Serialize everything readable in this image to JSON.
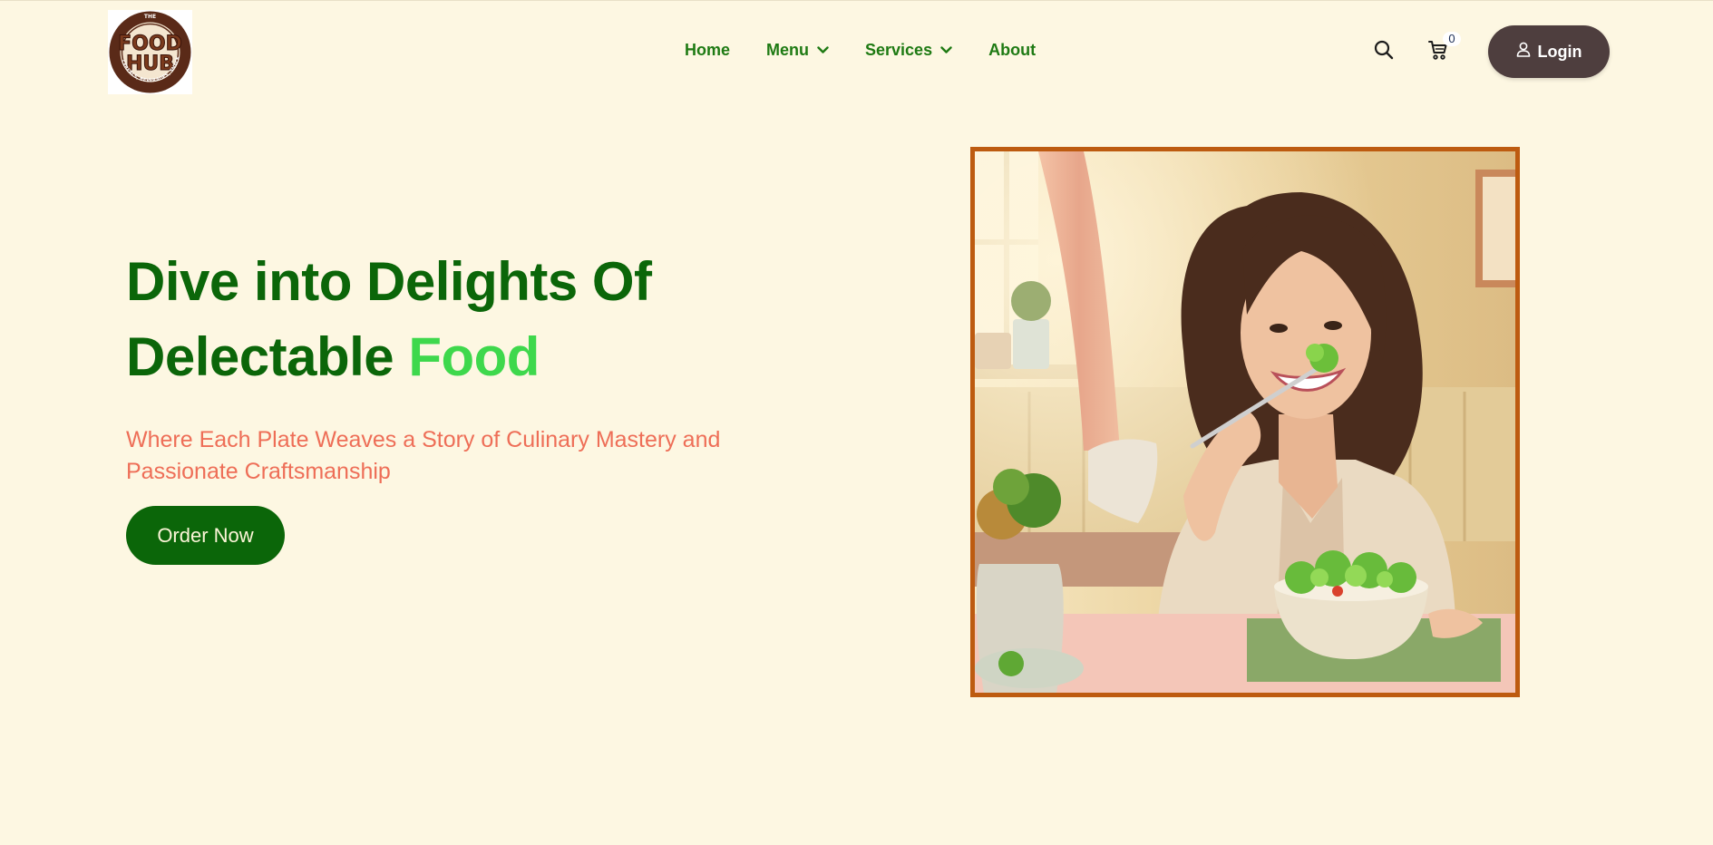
{
  "header": {
    "logo": {
      "top_text": "THE",
      "line1": "FOOD",
      "line2": "HUB",
      "ring_text": "CEREALS, BEVERAGES, SNACKS"
    },
    "nav": [
      {
        "label": "Home",
        "has_dropdown": false
      },
      {
        "label": "Menu",
        "has_dropdown": true
      },
      {
        "label": "Services",
        "has_dropdown": true
      },
      {
        "label": "About",
        "has_dropdown": false
      }
    ],
    "search_icon": "search-icon",
    "cart_icon": "cart-icon",
    "cart_count": "0",
    "login_label": "Login",
    "login_icon": "user-icon"
  },
  "hero": {
    "title_line1": "Dive into Delights Of",
    "title_line2_main": "Delectable ",
    "title_line2_accent": "Food",
    "subtitle": "Where Each Plate Weaves a Story of Culinary Mastery and Passionate Craftsmanship",
    "cta_label": "Order Now"
  },
  "colors": {
    "background": "#fdf7e2",
    "primary_green": "#0b6609",
    "nav_green": "#1e7a13",
    "accent_green": "#3ed84c",
    "subtitle_coral": "#ee6e57",
    "login_bg": "#4e3e3e",
    "image_border": "#bd5b10"
  }
}
